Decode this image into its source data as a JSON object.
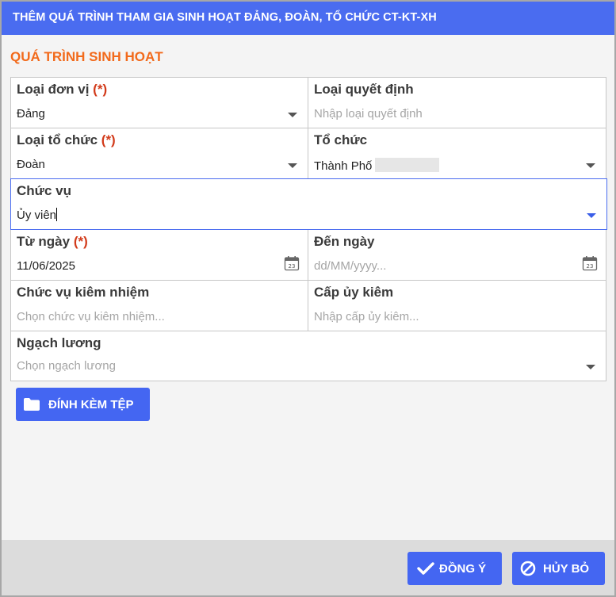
{
  "dialog": {
    "title": "THÊM QUÁ TRÌNH THAM GIA SINH HOẠT ĐẢNG, ĐOÀN, TỔ CHỨC CT-KT-XH",
    "section_title": "QUÁ TRÌNH SINH HOẠT"
  },
  "form": {
    "required_mark": "(*)",
    "loai_don_vi": {
      "label": "Loại đơn vị",
      "value": "Đảng"
    },
    "loai_quyet_dinh": {
      "label": "Loại quyết định",
      "placeholder": "Nhập loại quyết định"
    },
    "loai_to_chuc": {
      "label": "Loại tổ chức",
      "value": "Đoàn"
    },
    "to_chuc": {
      "label": "Tổ chức",
      "value": "Thành Phố"
    },
    "chuc_vu": {
      "label": "Chức vụ",
      "value": "Ủy viên"
    },
    "tu_ngay": {
      "label": "Từ ngày",
      "value": "11/06/2025",
      "calendar_day": "23"
    },
    "den_ngay": {
      "label": "Đến ngày",
      "placeholder": "dd/MM/yyyy...",
      "calendar_day": "23"
    },
    "chuc_vu_kiem_nhiem": {
      "label": "Chức vụ kiêm nhiệm",
      "placeholder": "Chọn chức vụ kiêm nhiệm..."
    },
    "cap_uy_kiem": {
      "label": "Cấp ủy kiêm",
      "placeholder": "Nhập cấp ủy kiêm..."
    },
    "ngach_luong": {
      "label": "Ngạch lương",
      "placeholder": "Chọn ngạch lương"
    }
  },
  "buttons": {
    "attach": "ĐÍNH KÈM TỆP",
    "ok": "ĐỒNG Ý",
    "cancel": "HỦY BỎ"
  },
  "icons": {
    "dropdown": "chevron-down-icon",
    "calendar": "calendar-icon",
    "folder": "folder-icon",
    "check": "check-icon",
    "cancel": "ban-icon"
  },
  "colors": {
    "title_bar": "#4a6cf0",
    "section_title": "#f26a1b",
    "required": "#d23b1b",
    "button": "#4466f2"
  }
}
